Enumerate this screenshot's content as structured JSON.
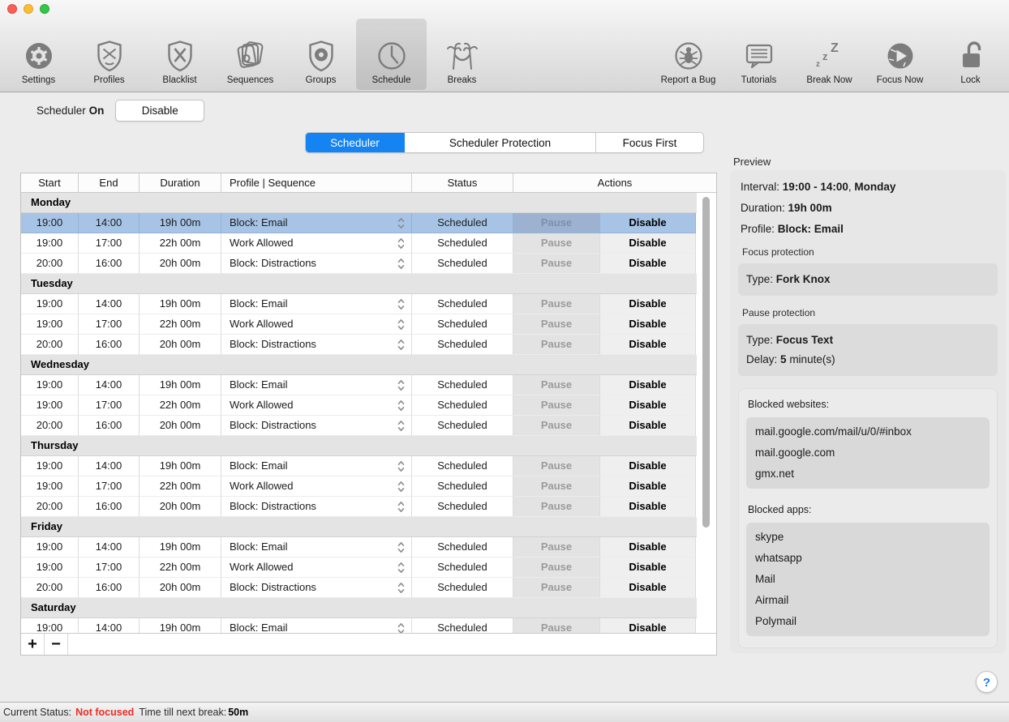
{
  "colors": {
    "accent_blue": "#1583f1",
    "selected_row": "#a7c4e6",
    "status_red": "#ea2e27"
  },
  "toolbar": {
    "left_items": [
      {
        "label": "Settings",
        "icon": "settings-icon",
        "selected": false
      },
      {
        "label": "Profiles",
        "icon": "profiles-icon",
        "selected": false
      },
      {
        "label": "Blacklist",
        "icon": "blacklist-icon",
        "selected": false
      },
      {
        "label": "Sequences",
        "icon": "sequences-icon",
        "selected": false
      },
      {
        "label": "Groups",
        "icon": "groups-icon",
        "selected": false
      },
      {
        "label": "Schedule",
        "icon": "schedule-icon",
        "selected": true
      },
      {
        "label": "Breaks",
        "icon": "breaks-icon",
        "selected": false
      }
    ],
    "right_items": [
      {
        "label": "Report a Bug",
        "icon": "bug-icon",
        "selected": false
      },
      {
        "label": "Tutorials",
        "icon": "tutorials-icon",
        "selected": false
      },
      {
        "label": "Break Now",
        "icon": "break-now-icon",
        "selected": false
      },
      {
        "label": "Focus Now",
        "icon": "focus-now-icon",
        "selected": false
      },
      {
        "label": "Lock",
        "icon": "lock-icon",
        "selected": false
      }
    ]
  },
  "scheduler_toggle": {
    "label": "Scheduler",
    "state": "On",
    "button_label": "Disable"
  },
  "tabs": [
    {
      "label": "Scheduler",
      "selected": true
    },
    {
      "label": "Scheduler Protection",
      "selected": false
    },
    {
      "label": "Focus First",
      "selected": false
    }
  ],
  "table": {
    "columns": [
      "Start",
      "End",
      "Duration",
      "Profile | Sequence",
      "Status",
      "Actions"
    ],
    "days": [
      {
        "name": "Monday",
        "rows": [
          {
            "start": "19:00",
            "end": "14:00",
            "duration": "19h 00m",
            "profile": "Block: Email",
            "status": "Scheduled",
            "pause": "Pause",
            "disable": "Disable",
            "selected": true
          },
          {
            "start": "19:00",
            "end": "17:00",
            "duration": "22h 00m",
            "profile": "Work Allowed",
            "status": "Scheduled",
            "pause": "Pause",
            "disable": "Disable",
            "selected": false
          },
          {
            "start": "20:00",
            "end": "16:00",
            "duration": "20h 00m",
            "profile": "Block: Distractions",
            "status": "Scheduled",
            "pause": "Pause",
            "disable": "Disable",
            "selected": false
          }
        ]
      },
      {
        "name": "Tuesday",
        "rows": [
          {
            "start": "19:00",
            "end": "14:00",
            "duration": "19h 00m",
            "profile": "Block: Email",
            "status": "Scheduled",
            "pause": "Pause",
            "disable": "Disable",
            "selected": false
          },
          {
            "start": "19:00",
            "end": "17:00",
            "duration": "22h 00m",
            "profile": "Work Allowed",
            "status": "Scheduled",
            "pause": "Pause",
            "disable": "Disable",
            "selected": false
          },
          {
            "start": "20:00",
            "end": "16:00",
            "duration": "20h 00m",
            "profile": "Block: Distractions",
            "status": "Scheduled",
            "pause": "Pause",
            "disable": "Disable",
            "selected": false
          }
        ]
      },
      {
        "name": "Wednesday",
        "rows": [
          {
            "start": "19:00",
            "end": "14:00",
            "duration": "19h 00m",
            "profile": "Block: Email",
            "status": "Scheduled",
            "pause": "Pause",
            "disable": "Disable",
            "selected": false
          },
          {
            "start": "19:00",
            "end": "17:00",
            "duration": "22h 00m",
            "profile": "Work Allowed",
            "status": "Scheduled",
            "pause": "Pause",
            "disable": "Disable",
            "selected": false
          },
          {
            "start": "20:00",
            "end": "16:00",
            "duration": "20h 00m",
            "profile": "Block: Distractions",
            "status": "Scheduled",
            "pause": "Pause",
            "disable": "Disable",
            "selected": false
          }
        ]
      },
      {
        "name": "Thursday",
        "rows": [
          {
            "start": "19:00",
            "end": "14:00",
            "duration": "19h 00m",
            "profile": "Block: Email",
            "status": "Scheduled",
            "pause": "Pause",
            "disable": "Disable",
            "selected": false
          },
          {
            "start": "19:00",
            "end": "17:00",
            "duration": "22h 00m",
            "profile": "Work Allowed",
            "status": "Scheduled",
            "pause": "Pause",
            "disable": "Disable",
            "selected": false
          },
          {
            "start": "20:00",
            "end": "16:00",
            "duration": "20h 00m",
            "profile": "Block: Distractions",
            "status": "Scheduled",
            "pause": "Pause",
            "disable": "Disable",
            "selected": false
          }
        ]
      },
      {
        "name": "Friday",
        "rows": [
          {
            "start": "19:00",
            "end": "14:00",
            "duration": "19h 00m",
            "profile": "Block: Email",
            "status": "Scheduled",
            "pause": "Pause",
            "disable": "Disable",
            "selected": false
          },
          {
            "start": "19:00",
            "end": "17:00",
            "duration": "22h 00m",
            "profile": "Work Allowed",
            "status": "Scheduled",
            "pause": "Pause",
            "disable": "Disable",
            "selected": false
          },
          {
            "start": "20:00",
            "end": "16:00",
            "duration": "20h 00m",
            "profile": "Block: Distractions",
            "status": "Scheduled",
            "pause": "Pause",
            "disable": "Disable",
            "selected": false
          }
        ]
      },
      {
        "name": "Saturday",
        "rows": [
          {
            "start": "19:00",
            "end": "14:00",
            "duration": "19h 00m",
            "profile": "Block: Email",
            "status": "Scheduled",
            "pause": "Pause",
            "disable": "Disable",
            "selected": false
          }
        ]
      }
    ],
    "footer": {
      "add_label": "+",
      "remove_label": "−"
    }
  },
  "preview": {
    "title": "Preview",
    "interval_label": "Interval:",
    "interval_value": "19:00 - 14:00",
    "interval_sep": ",",
    "interval_day": "Monday",
    "duration_label": "Duration:",
    "duration_value": "19h 00m",
    "profile_label": "Profile:",
    "profile_value": "Block: Email",
    "focus_protection": {
      "label": "Focus protection",
      "type_label": "Type:",
      "type_value": "Fork Knox"
    },
    "pause_protection": {
      "label": "Pause protection",
      "type_label": "Type:",
      "type_value": "Focus Text",
      "delay_label": "Delay:",
      "delay_value": "5",
      "delay_suffix": "minute(s)"
    },
    "blocked_websites": {
      "label": "Blocked websites:",
      "items": [
        "mail.google.com/mail/u/0/#inbox",
        "mail.google.com",
        "gmx.net"
      ]
    },
    "blocked_apps": {
      "label": "Blocked apps:",
      "items": [
        "skype",
        "whatsapp",
        "Mail",
        "Airmail",
        "Polymail"
      ]
    }
  },
  "help_button_label": "?",
  "status_bar": {
    "status_label": "Current Status:",
    "status_value": "Not focused",
    "break_label": "Time till next break:",
    "break_value": "50m"
  }
}
